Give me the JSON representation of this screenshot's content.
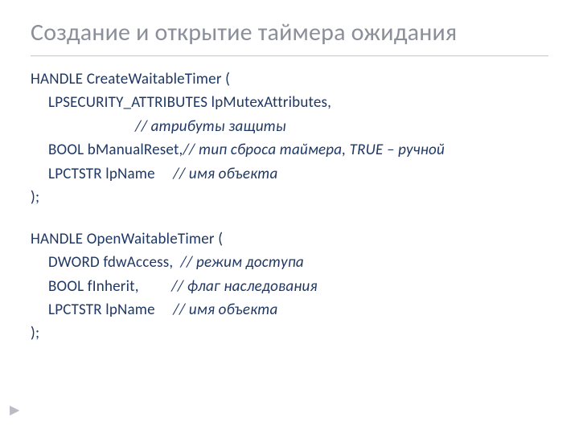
{
  "title": "Создание и открытие таймера ожидания",
  "func1": {
    "sig": "HANDLE CreateWaitableTimer (",
    "p1": "LPSECURITY_ATTRIBUTES lpMutexAttributes,",
    "p1c": "// атрибуты защиты",
    "p2a": "BOOL bManualReset,",
    "p2b": "// тип сброса таймера, TRUE – ручной",
    "p3a": "LPCTSTR lpName",
    "p3b": "// имя объекта",
    "close": ");"
  },
  "func2": {
    "sig": "HANDLE OpenWaitableTimer (",
    "p1a": "DWORD fdwAccess,",
    "p1b": "// режим доступа",
    "p2a": "BOOL fInherit,",
    "p2b": "// флаг наследования",
    "p3a": "LPCTSTR lpName",
    "p3b": "// имя объекта",
    "close": ");"
  },
  "marker": "▶"
}
